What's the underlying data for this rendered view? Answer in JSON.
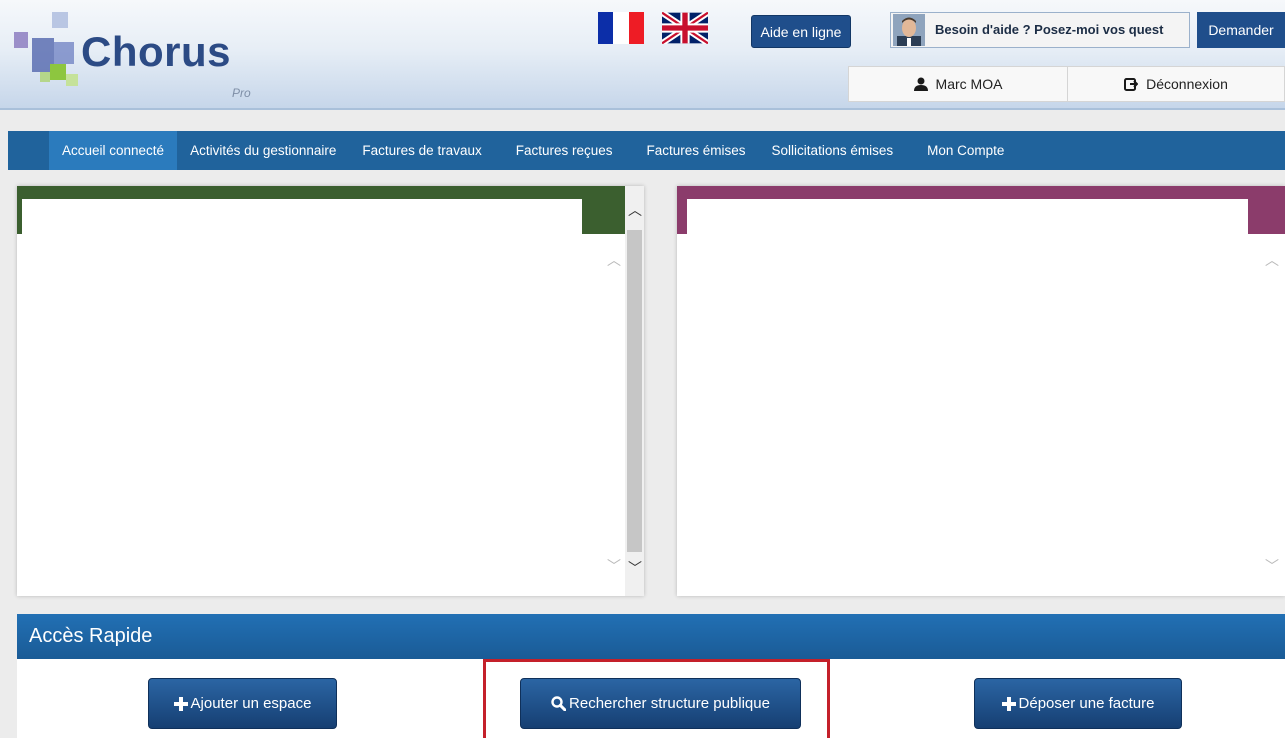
{
  "header": {
    "logo_text": "Chorus",
    "logo_sub": "Pro",
    "aide_label": "Aide en ligne",
    "chat_text": "Besoin d'aide ? Posez-moi vos quest",
    "demander_label": "Demander",
    "user_name": "Marc MOA",
    "logout_label": "Déconnexion",
    "colors": {
      "brand": "#2c4b85",
      "button": "#1f4e8b"
    }
  },
  "nav": {
    "items": [
      {
        "label": "Accueil connecté"
      },
      {
        "label": "Activités du gestionnaire"
      },
      {
        "label": "Factures de travaux"
      },
      {
        "label": "Factures reçues"
      },
      {
        "label": "Factures émises"
      },
      {
        "label": "Sollicitations émises"
      },
      {
        "label": "Mon Compte"
      }
    ],
    "active_index": 0,
    "color": "#20639c"
  },
  "panels": {
    "left_color": "#3b5f2f",
    "right_color": "#8b3c6b"
  },
  "acces": {
    "title": "Accès Rapide",
    "buttons": [
      {
        "label": "Ajouter un espace",
        "icon": "plus-icon"
      },
      {
        "label": "Rechercher structure publique",
        "icon": "search-icon"
      },
      {
        "label": "Déposer une facture",
        "icon": "plus-icon"
      }
    ],
    "highlight_color": "#c4202a"
  }
}
